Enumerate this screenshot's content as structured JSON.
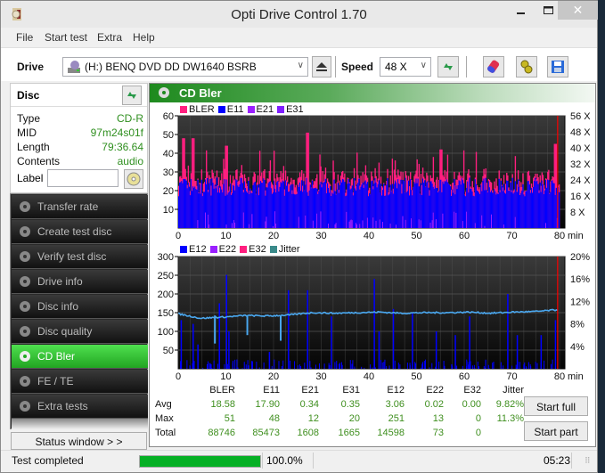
{
  "window": {
    "title": "Opti Drive Control 1.70",
    "close_glyph": "✕",
    "min_glyph": "▁",
    "max_glyph": "☐"
  },
  "menu": [
    "File",
    "Start test",
    "Extra",
    "Help"
  ],
  "toolbar": {
    "drive_label": "Drive",
    "drive_value": "(H:)   BENQ DVD DD DW1640 BSRB",
    "speed_label": "Speed",
    "speed_value": "48 X",
    "icons": [
      "eject-icon",
      "refresh-icon",
      "erase-icon",
      "settings-icon",
      "save-icon"
    ]
  },
  "disc": {
    "title": "Disc",
    "fields": [
      {
        "key": "Type",
        "value": "CD-R"
      },
      {
        "key": "MID",
        "value": "97m24s01f"
      },
      {
        "key": "Length",
        "value": "79:36.64"
      },
      {
        "key": "Contents",
        "value": "audio"
      }
    ],
    "label_key": "Label",
    "label_value": ""
  },
  "nav": [
    {
      "label": "Transfer rate",
      "active": false
    },
    {
      "label": "Create test disc",
      "active": false
    },
    {
      "label": "Verify test disc",
      "active": false
    },
    {
      "label": "Drive info",
      "active": false
    },
    {
      "label": "Disc info",
      "active": false
    },
    {
      "label": "Disc quality",
      "active": false
    },
    {
      "label": "CD Bler",
      "active": true
    },
    {
      "label": "FE / TE",
      "active": false
    },
    {
      "label": "Extra tests",
      "active": false
    }
  ],
  "status_window_button": "Status window > >",
  "panel_title": "CD Bler",
  "colors": {
    "bler": "#ff1f7f",
    "e11": "#0000ff",
    "e21": "#9a1fff",
    "e31": "#7f1fff",
    "e12": "#0000ff",
    "e22": "#9a1fff",
    "e32": "#ff1f7f",
    "jitter": "#4aa8f0",
    "accent_green": "#22a522",
    "marker_red": "#ff0000"
  },
  "chart_data": [
    {
      "type": "bar",
      "title": "CD Bler upper",
      "legend": [
        "BLER",
        "E11",
        "E21",
        "E31"
      ],
      "xlabel": "min",
      "x_ticks": [
        "0",
        "10",
        "20",
        "30",
        "40",
        "50",
        "60",
        "70",
        "80"
      ],
      "y_ticks": [
        "10",
        "20",
        "30",
        "40",
        "50",
        "60"
      ],
      "y2_ticks": [
        "8 X",
        "16 X",
        "24 X",
        "32 X",
        "40 X",
        "48 X",
        "56 X"
      ],
      "xlim": [
        0,
        80
      ],
      "ylim": [
        0,
        60
      ],
      "y2lim": [
        0,
        56
      ],
      "series_summary": {
        "BLER": {
          "typical": 24,
          "peaks": [
            [
              1,
              48
            ],
            [
              3,
              48
            ],
            [
              10,
              44
            ],
            [
              27,
              51
            ],
            [
              55,
              42
            ],
            [
              79,
              45
            ]
          ]
        },
        "E11": {
          "typical": 22,
          "peaks": [
            [
              1,
              48
            ],
            [
              36,
              40
            ],
            [
              61,
              37
            ]
          ]
        },
        "E21": {
          "typical": 2
        },
        "E31": {
          "typical": 1
        }
      },
      "grid": true
    },
    {
      "type": "bar",
      "title": "CD Bler lower",
      "legend": [
        "E12",
        "E22",
        "E32",
        "Jitter"
      ],
      "xlabel": "min",
      "x_ticks": [
        "0",
        "10",
        "20",
        "30",
        "40",
        "50",
        "60",
        "70",
        "80"
      ],
      "y_ticks": [
        "50",
        "100",
        "150",
        "200",
        "250",
        "300"
      ],
      "y2_ticks": [
        "4%",
        "8%",
        "12%",
        "16%",
        "20%"
      ],
      "xlim": [
        0,
        80
      ],
      "ylim": [
        0,
        300
      ],
      "y2lim": [
        0,
        20
      ],
      "e12_peaks": [
        [
          0.5,
          130
        ],
        [
          3,
          120
        ],
        [
          4,
          65
        ],
        [
          8.5,
          175
        ],
        [
          10,
          251
        ],
        [
          10.5,
          100
        ],
        [
          19,
          45
        ],
        [
          23,
          210
        ],
        [
          27,
          210
        ],
        [
          32,
          140
        ],
        [
          41,
          240
        ],
        [
          42,
          100
        ],
        [
          45,
          160
        ],
        [
          49,
          150
        ],
        [
          54,
          100
        ],
        [
          58,
          90
        ],
        [
          61,
          140
        ],
        [
          69,
          200
        ],
        [
          71,
          90
        ],
        [
          76,
          90
        ],
        [
          79,
          130
        ]
      ],
      "jitter_values": [
        9.8,
        9.0,
        9.2,
        9.5,
        9.4,
        9.6,
        10.0,
        9.9,
        10.0,
        10.1,
        9.9,
        10.0,
        10.0,
        10.1,
        9.9,
        10.1,
        10.2,
        10.5
      ],
      "grid": true
    }
  ],
  "stats": {
    "columns": [
      "BLER",
      "E11",
      "E21",
      "E31",
      "E12",
      "E22",
      "E32",
      "Jitter"
    ],
    "rows": [
      {
        "label": "Avg",
        "values": [
          "18.58",
          "17.90",
          "0.34",
          "0.35",
          "3.06",
          "0.02",
          "0.00",
          "9.82%"
        ]
      },
      {
        "label": "Max",
        "values": [
          "51",
          "48",
          "12",
          "20",
          "251",
          "13",
          "0",
          "11.3%"
        ]
      },
      {
        "label": "Total",
        "values": [
          "88746",
          "85473",
          "1608",
          "1665",
          "14598",
          "73",
          "0",
          ""
        ]
      }
    ]
  },
  "buttons": {
    "start_full": "Start full",
    "start_part": "Start part"
  },
  "statusbar": {
    "text": "Test completed",
    "progress": 100.0,
    "progress_label": "100.0%",
    "time": "05:23"
  }
}
